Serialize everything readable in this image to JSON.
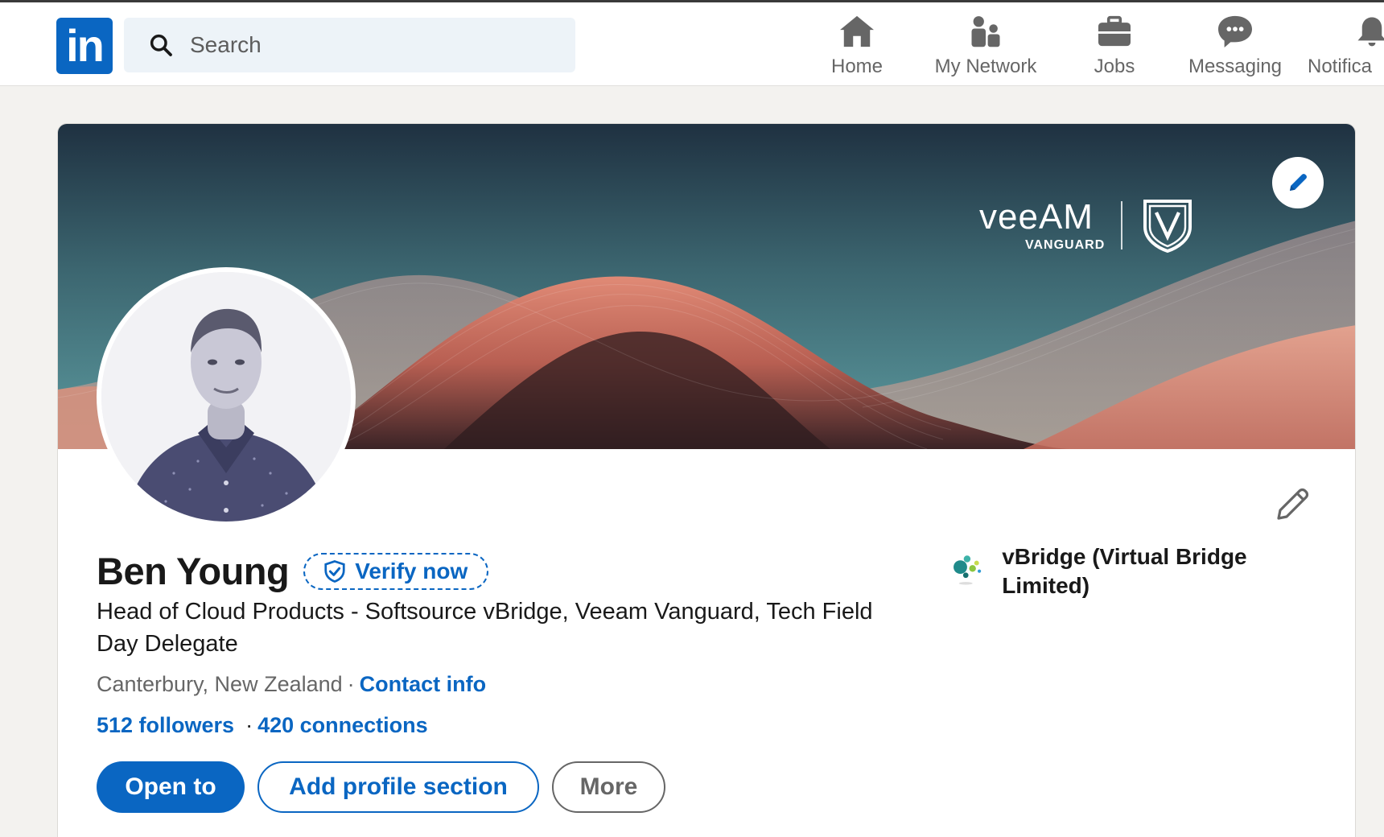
{
  "nav": {
    "logo_text": "in",
    "search_placeholder": "Search",
    "items": [
      {
        "label": "Home",
        "icon": "home-icon"
      },
      {
        "label": "My Network",
        "icon": "people-icon"
      },
      {
        "label": "Jobs",
        "icon": "briefcase-icon"
      },
      {
        "label": "Messaging",
        "icon": "chat-icon"
      },
      {
        "label": "Notifica",
        "icon": "bell-icon"
      }
    ]
  },
  "banner": {
    "brand_word": "veeAM",
    "brand_sub": "VANGUARD",
    "brand_color": "#ffffff"
  },
  "profile": {
    "name": "Ben Young",
    "verify_label": "Verify now",
    "headline": "Head of Cloud Products - Softsource vBridge, Veeam Vanguard, Tech Field Day Delegate",
    "location": "Canterbury, New Zealand",
    "location_sep": "·",
    "contact_info": "Contact info",
    "followers": "512 followers",
    "stats_sep": "·",
    "connections": "420 connections",
    "company": "vBridge (Virtual Bridge Limited)"
  },
  "actions": {
    "open_to": "Open to",
    "add_section": "Add profile section",
    "more": "More"
  },
  "colors": {
    "accent": "#0a66c2",
    "page_bg": "#f3f2ef",
    "text": "#191919",
    "muted": "#666666"
  }
}
